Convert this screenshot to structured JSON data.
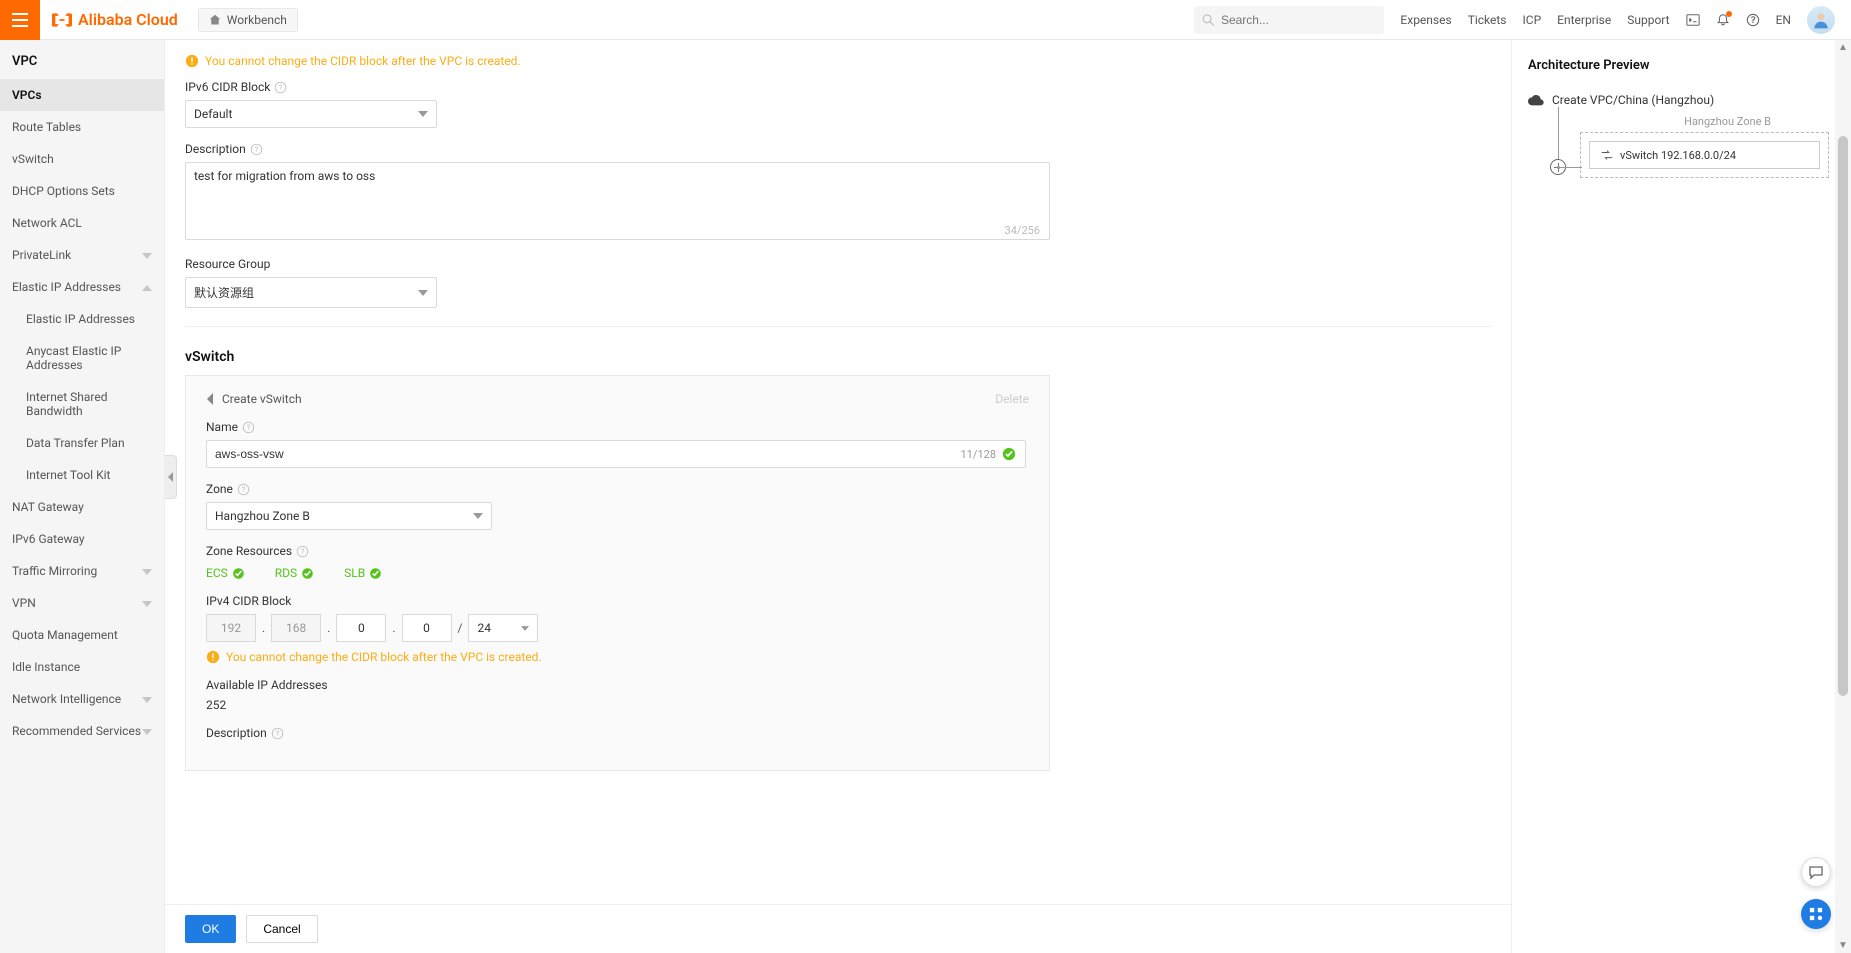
{
  "header": {
    "brand": "Alibaba Cloud",
    "workbench": "Workbench",
    "search_placeholder": "Search...",
    "links": {
      "expenses": "Expenses",
      "tickets": "Tickets",
      "icp": "ICP",
      "enterprise": "Enterprise",
      "support": "Support"
    },
    "lang": "EN"
  },
  "sidebar": {
    "title": "VPC",
    "items": [
      {
        "label": "VPCs",
        "active": true
      },
      {
        "label": "Route Tables"
      },
      {
        "label": "vSwitch"
      },
      {
        "label": "DHCP Options Sets"
      },
      {
        "label": "Network ACL"
      },
      {
        "label": "PrivateLink",
        "exp": "down"
      },
      {
        "label": "Elastic IP Addresses",
        "exp": "up",
        "children": [
          {
            "label": "Elastic IP Addresses"
          },
          {
            "label": "Anycast Elastic IP Addresses"
          },
          {
            "label": "Internet Shared Bandwidth"
          },
          {
            "label": "Data Transfer Plan"
          },
          {
            "label": "Internet Tool Kit"
          }
        ]
      },
      {
        "label": "NAT Gateway"
      },
      {
        "label": "IPv6 Gateway"
      },
      {
        "label": "Traffic Mirroring",
        "exp": "down"
      },
      {
        "label": "VPN",
        "exp": "down"
      },
      {
        "label": "Quota Management"
      },
      {
        "label": "Idle Instance"
      },
      {
        "label": "Network Intelligence",
        "exp": "down"
      },
      {
        "label": "Recommended Services",
        "exp": "down"
      }
    ]
  },
  "form": {
    "cidr_warning": "You cannot change the CIDR block after the VPC is created.",
    "ipv6_label": "IPv6 CIDR Block",
    "ipv6_value": "Default",
    "desc_label": "Description",
    "desc_value": "test for migration from aws to oss",
    "desc_counter": "34/256",
    "rg_label": "Resource Group",
    "rg_value": "默认资源组",
    "vswitch_title": "vSwitch",
    "panel": {
      "create_label": "Create vSwitch",
      "delete_label": "Delete",
      "name_label": "Name",
      "name_value": "aws-oss-vsw",
      "name_counter": "11/128",
      "zone_label": "Zone",
      "zone_value": "Hangzhou Zone B",
      "zr_label": "Zone Resources",
      "zr": {
        "ecs": "ECS",
        "rds": "RDS",
        "slb": "SLB"
      },
      "ipv4_label": "IPv4 CIDR Block",
      "cidr": {
        "a": "192",
        "b": "168",
        "c": "0",
        "d": "0",
        "mask": "24"
      },
      "cidr_warning": "You cannot change the CIDR block after the VPC is created.",
      "avail_label": "Available IP Addresses",
      "avail_value": "252",
      "desc2_label": "Description"
    }
  },
  "preview": {
    "title": "Architecture Preview",
    "vpc_label": "Create VPC/China (Hangzhou)",
    "zone_label": "Hangzhou Zone B",
    "sw_label": "vSwitch 192.168.0.0/24"
  },
  "footer": {
    "ok": "OK",
    "cancel": "Cancel"
  }
}
